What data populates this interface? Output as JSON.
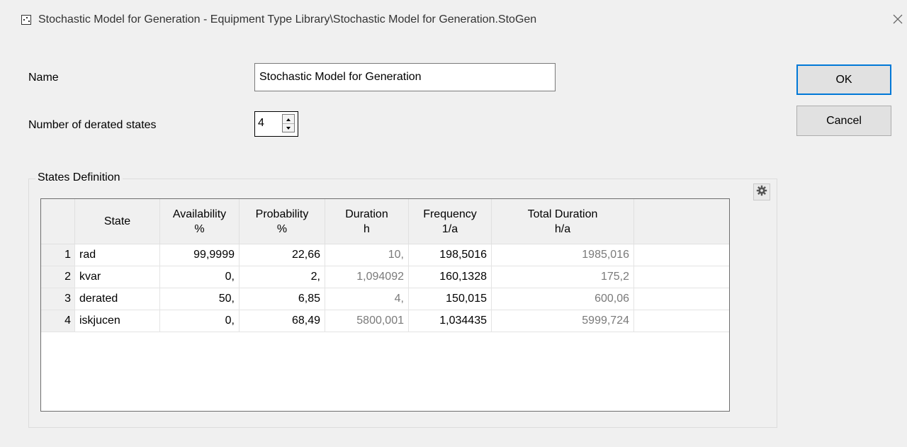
{
  "window": {
    "title": "Stochastic Model for Generation - Equipment Type Library\\Stochastic Model for Generation.StoGen"
  },
  "form": {
    "name_label": "Name",
    "name_value": "Stochastic Model for Generation",
    "derated_label": "Number of derated states",
    "derated_value": "4"
  },
  "buttons": {
    "ok": "OK",
    "cancel": "Cancel"
  },
  "states": {
    "group_title": "States Definition",
    "columns": [
      {
        "line1": "State",
        "line2": ""
      },
      {
        "line1": "Availability",
        "line2": "%"
      },
      {
        "line1": "Probability",
        "line2": "%"
      },
      {
        "line1": "Duration",
        "line2": "h"
      },
      {
        "line1": "Frequency",
        "line2": "1/a"
      },
      {
        "line1": "Total Duration",
        "line2": "h/a"
      }
    ],
    "rows": [
      {
        "num": "1",
        "state": "rad",
        "availability": "99,9999",
        "probability": "22,66",
        "duration": "10,",
        "frequency": "198,5016",
        "total": "1985,016"
      },
      {
        "num": "2",
        "state": "kvar",
        "availability": "0,",
        "probability": "2,",
        "duration": "1,094092",
        "frequency": "160,1328",
        "total": "175,2"
      },
      {
        "num": "3",
        "state": "derated",
        "availability": "50,",
        "probability": "6,85",
        "duration": "4,",
        "frequency": "150,015",
        "total": "600,06"
      },
      {
        "num": "4",
        "state": "iskjucen",
        "availability": "0,",
        "probability": "68,49",
        "duration": "5800,001",
        "frequency": "1,034435",
        "total": "5999,724"
      }
    ]
  },
  "icons": {
    "app": "dialog-icon",
    "close": "close-icon",
    "spin_up": "spin-up-icon",
    "spin_down": "spin-down-icon",
    "settings": "gear-icon"
  },
  "colors": {
    "background": "#f0f0f0",
    "ok_border": "#0078d7",
    "computed_text": "#7a7a7a"
  }
}
